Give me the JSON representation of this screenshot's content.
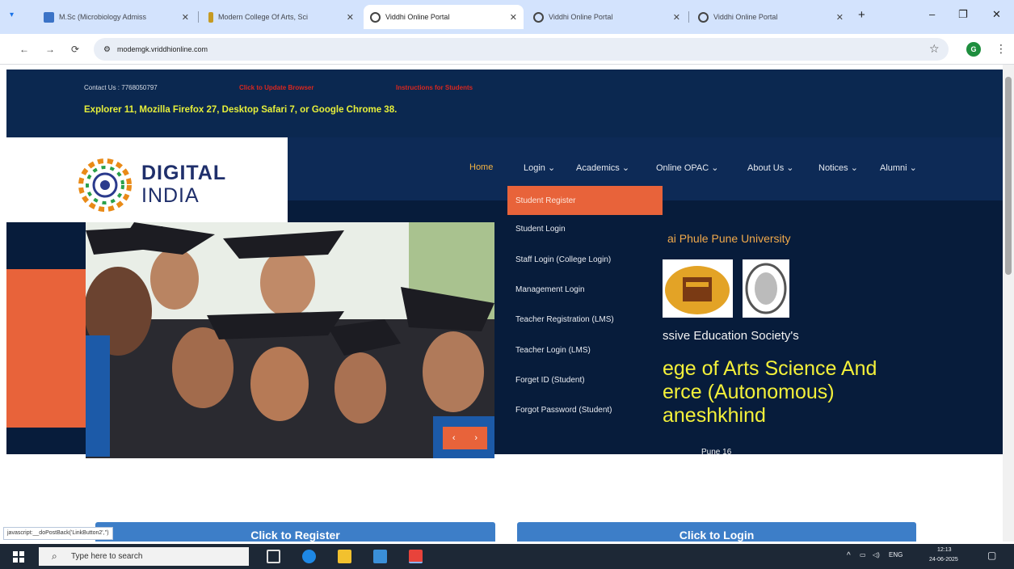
{
  "browser": {
    "tabs": [
      {
        "title": "M.Sc (Microbiology Admiss",
        "icon_color": "#3b73c7"
      },
      {
        "title": "Modern College Of Arts, Sci",
        "icon_color": "#c69a22"
      },
      {
        "title": "Viddhi Online Portal",
        "icon_color": "#444444"
      },
      {
        "title": "Viddhi Online Portal",
        "icon_color": "#444444"
      },
      {
        "title": "Viddhi Online Portal",
        "icon_color": "#444444"
      }
    ],
    "new_tab": "+",
    "minimize": "–",
    "maximize": "❐",
    "close": "✕",
    "url": "modemgk.vriddhionline.com",
    "back": "←",
    "forward": "→",
    "reload": "⟳",
    "star": "☆",
    "profile": "G",
    "more": "⋮"
  },
  "header": {
    "contact": "Contact Us : 7768050797",
    "update_browser": "Click to Update Browser",
    "instructions": "Instructions for Students",
    "marquee": "Explorer 11, Mozilla Firefox 27, Desktop Safari 7, or Google Chrome 38."
  },
  "logo": {
    "line1": "DIGITAL",
    "line2": "INDIA"
  },
  "nav": {
    "home": "Home",
    "login": "Login ⌄",
    "academics": "Academics ⌄",
    "opac": "Online OPAC ⌄",
    "about": "About Us ⌄",
    "notices": "Notices ⌄",
    "alumni": "Alumni ⌄"
  },
  "dropdown": {
    "items": [
      "Student Register",
      "Student Login",
      "Staff Login (College Login)",
      "Management Login",
      "Teacher Registration (LMS)",
      "Teacher Login (LMS)",
      "Forget ID (Student)",
      "Forgot Password (Student)"
    ]
  },
  "hero": {
    "university": "ai Phule Pune University",
    "society": "ssive Education Society's",
    "college": "ege of Arts Science And\nerce (Autonomous)\naneshkhind",
    "pune": "Pune 16",
    "prev": "‹",
    "next": "›"
  },
  "buttons": {
    "register": "Click to Register",
    "login": "Click to Login"
  },
  "status_bar": "javascript:__doPostBack('LinkButton2','')",
  "taskbar": {
    "search_placeholder": "Type here to search",
    "lang": "ENG",
    "time": "12:13",
    "date": "24-06-2025"
  },
  "colors": {
    "navy": "#0b2850",
    "accent": "#e8633a",
    "yellow": "#e6ef3a",
    "button_blue": "#3d7ec8"
  }
}
